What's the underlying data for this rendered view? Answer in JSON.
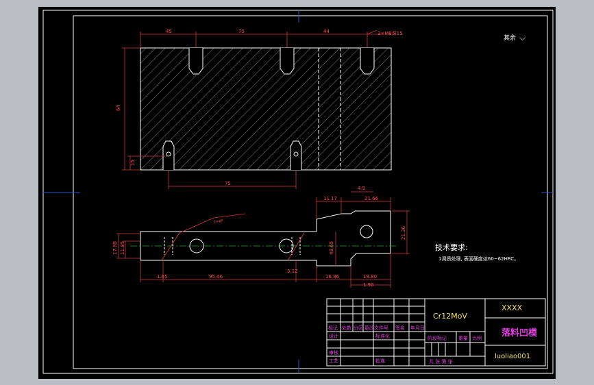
{
  "colors": {
    "background": "#b9bec5",
    "canvas": "#000000",
    "frame": "#ffffff",
    "dimension": "#d23a3a",
    "text_yellow": "#f0e05a",
    "text_magenta": "#e040e0",
    "text_white": "#ffffff",
    "center_line": "#1fae2b",
    "edge_marks": "#2b54d0"
  },
  "top_view": {
    "dims": {
      "d45": "45",
      "d75": "75",
      "d44": "44",
      "holes": "3×M8深15",
      "height": "64",
      "bottom_offset": "15",
      "bottom_span": "75"
    }
  },
  "surface_note": {
    "label": "其余",
    "symbol": "⌵"
  },
  "side_view": {
    "dims": {
      "d1785": "17.85",
      "d1185": "11.85",
      "d165": "1.65",
      "d9546": "95.46",
      "d312": "3.12",
      "d1686": "16.86",
      "d1980": "19.80",
      "d190": "1.90",
      "d1117": "11.17",
      "d2166": "21.66",
      "d49": "4.9",
      "d2136": "21.36",
      "d4865": "48.65",
      "leader": "2×φ8"
    }
  },
  "tech_notes": {
    "title": "技术要求:",
    "line1": "1调质处理, 表面硬度达60~62HRC。"
  },
  "title_block": {
    "material": "Cr12MoV",
    "company": "XXXX",
    "part_name": "落料凹模",
    "drawing_no": "luoliao001",
    "row_labels": [
      "标记",
      "处数",
      "分区",
      "更改文件号",
      "签名",
      "年月日"
    ],
    "design_label": "设计",
    "standard_label": "标准化",
    "stage_label": "阶段标记",
    "weight_label": "重量",
    "scale_label": "比例",
    "review_label": "审核",
    "process_label": "工艺",
    "approve_label": "批准",
    "sheets_label": "共 张 第 张"
  }
}
